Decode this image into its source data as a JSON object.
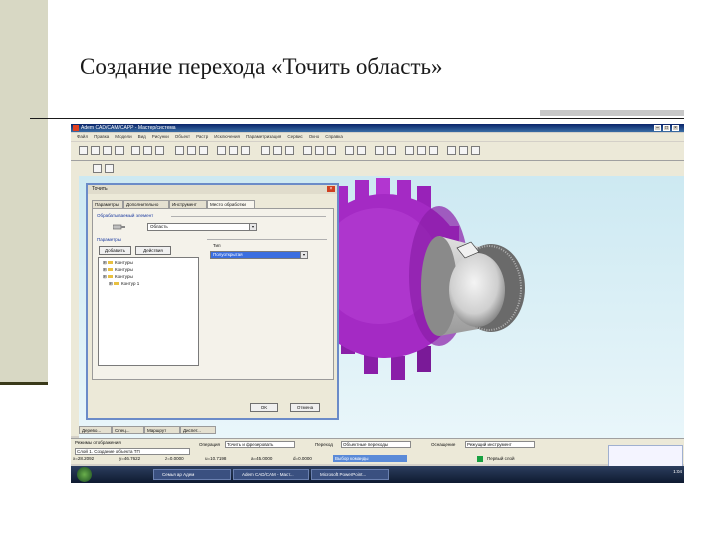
{
  "slide": {
    "title": "Создание перехода «Точить область»"
  },
  "app": {
    "window_title": "Adem CAD/CAM/CAPP - Мастер/система",
    "menu": [
      "Файл",
      "Правка",
      "Модели",
      "Вид",
      "Рисунки",
      "Объект",
      "Растр",
      "Исключения",
      "Параметризация",
      "Сервис",
      "Окно",
      "Справка"
    ]
  },
  "dialog": {
    "title": "Точить",
    "tabs": [
      "Параметры",
      "Дополнительно",
      "Инструмент",
      "Место обработки"
    ],
    "machined_element_label": "Обрабатываемый элемент",
    "machined_element_value": "Область",
    "params_label": "Параметры",
    "add_button": "Добавить",
    "actions_button": "Действия",
    "tree": [
      "Контуры",
      "Контуры",
      "Контуры",
      "Контур 1"
    ],
    "type_label": "Тип",
    "type_value": "Полуоткрытая",
    "ok_button": "OK",
    "cancel_button": "Отмена"
  },
  "bottom_tabs": [
    "Дерево...",
    "Спец...",
    "Маршрут",
    "Диспет..."
  ],
  "status": {
    "layers_label": "Режимы отображения",
    "layers_value": "Слой 1. Создание объекта ТП",
    "operation_label": "Операция",
    "operation_value": "Точить и фрезеровать",
    "transition_label": "Переход",
    "transition_value": "Объектные переходы",
    "equipment_label": "Оснащение",
    "equipment_value": "Режущий инструмент",
    "coords": [
      "x=28.2092",
      "y=46.7622",
      "z=0.0000",
      "u=10.7198",
      "a=45.0000",
      "d=0.0000"
    ],
    "prompt": "Выбор команды",
    "layer_status": "Первый слой"
  },
  "taskbar": {
    "tasks": [
      "Семья ар Адем",
      "Adem CAD/CAM - Маст...",
      "Microsoft PowerPoint..."
    ],
    "clock": "1:04"
  },
  "colors": {
    "part": "#a42ac4",
    "viewport_bg": "#cde9f2"
  }
}
